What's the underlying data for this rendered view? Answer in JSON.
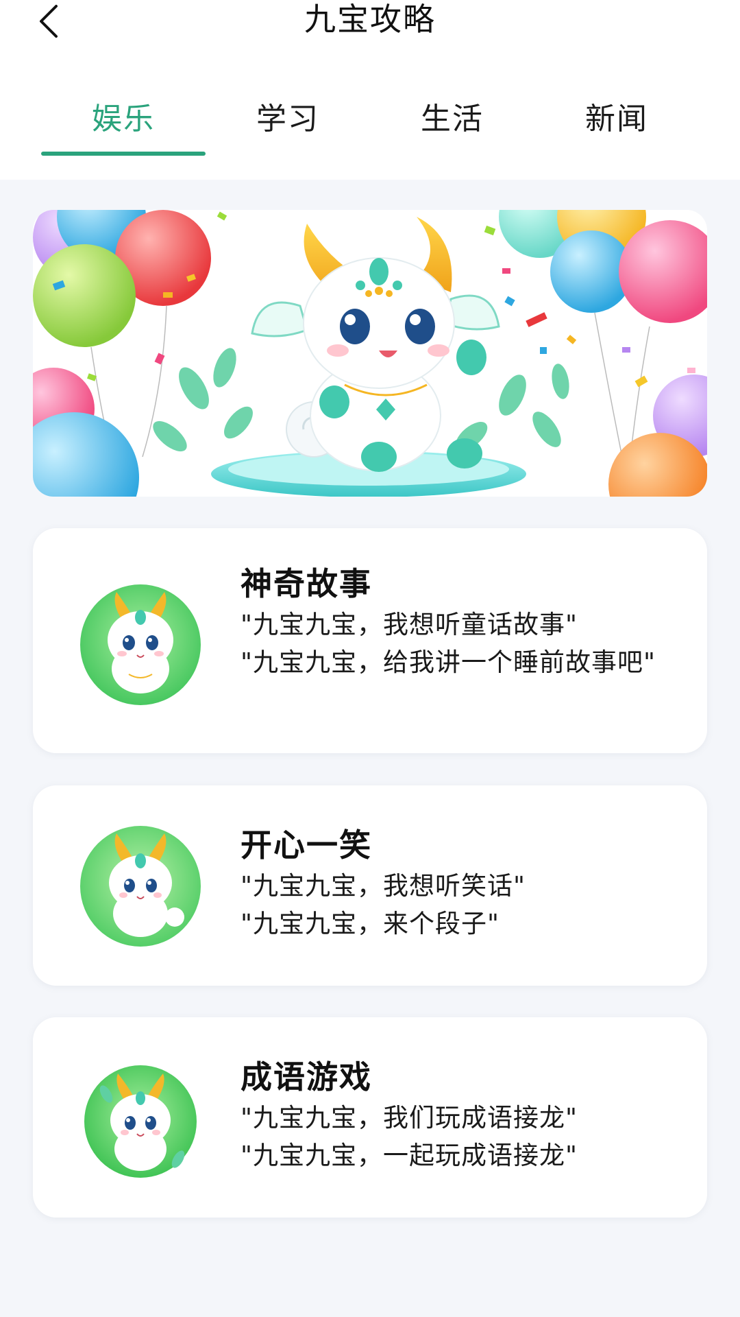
{
  "header": {
    "title": "九宝攻略",
    "back_icon": "chevron-left-icon"
  },
  "tabs": [
    {
      "label": "娱乐",
      "active": true
    },
    {
      "label": "学习",
      "active": false
    },
    {
      "label": "生活",
      "active": false
    },
    {
      "label": "新闻",
      "active": false
    }
  ],
  "colors": {
    "accent": "#2aa37c",
    "background": "#f4f6fa",
    "card": "#ffffff"
  },
  "banner": {
    "icon": "mascot-dragon-balloons-illustration"
  },
  "cards": [
    {
      "title": "神奇故事",
      "lines": [
        "\"九宝九宝，我想听童话故事\"",
        "\"九宝九宝，给我讲一个睡前故事吧\""
      ],
      "icon": "mascot-avatar-icon"
    },
    {
      "title": "开心一笑",
      "lines": [
        "\"九宝九宝，我想听笑话\"",
        "\"九宝九宝，来个段子\""
      ],
      "icon": "mascot-avatar-icon"
    },
    {
      "title": "成语游戏",
      "lines": [
        "\"九宝九宝，我们玩成语接龙\"",
        "\"九宝九宝，一起玩成语接龙\""
      ],
      "icon": "mascot-avatar-icon"
    }
  ]
}
